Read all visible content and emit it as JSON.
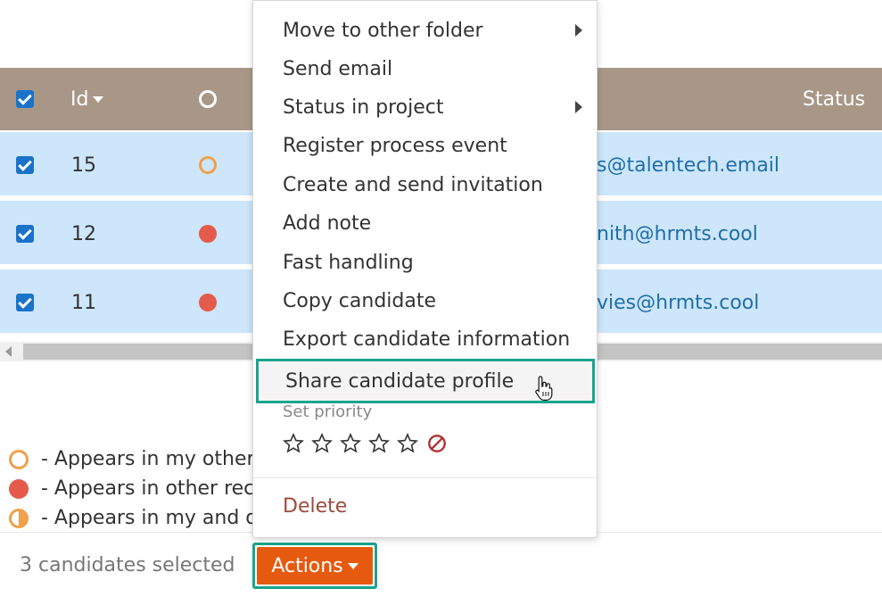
{
  "table": {
    "header": {
      "id_label": "Id",
      "status_label": "Status"
    },
    "rows": [
      {
        "id": "15",
        "email": "s@talentech.email",
        "marker": "ring"
      },
      {
        "id": "12",
        "email": "nith@hrmts.cool",
        "marker": "fill"
      },
      {
        "id": "11",
        "email": "vies@hrmts.cool",
        "marker": "fill"
      }
    ]
  },
  "legend": [
    {
      "symbol": "ring",
      "text": "- Appears in my other"
    },
    {
      "symbol": "fill",
      "text": "- Appears in other rec"
    },
    {
      "symbol": "half",
      "text": "- Appears in my and o"
    }
  ],
  "footer": {
    "selected_text": "3 candidates selected",
    "actions_label": "Actions"
  },
  "menu": {
    "items": [
      {
        "label": "Move to other folder",
        "has_submenu": true
      },
      {
        "label": "Send email",
        "has_submenu": false
      },
      {
        "label": "Status in project",
        "has_submenu": true
      },
      {
        "label": "Register process event",
        "has_submenu": false
      },
      {
        "label": "Create and send invitation",
        "has_submenu": false
      },
      {
        "label": "Add note",
        "has_submenu": false
      },
      {
        "label": "Fast handling",
        "has_submenu": false
      },
      {
        "label": "Copy candidate",
        "has_submenu": false
      },
      {
        "label": "Export candidate information",
        "has_submenu": false
      },
      {
        "label": "Share candidate profile",
        "has_submenu": false,
        "highlighted": true
      }
    ],
    "priority_label": "Set priority",
    "priority_stars": 5,
    "delete_label": "Delete"
  },
  "colors": {
    "header_bg": "#a89787",
    "row_selected_bg": "#cde6fb",
    "accent_orange": "#e65a0f",
    "highlight_border": "#18a58c",
    "checkbox_blue": "#1a73c9",
    "marker_orange": "#f0a04b",
    "marker_red": "#e45b4b",
    "delete_text": "#9c4a3c"
  }
}
